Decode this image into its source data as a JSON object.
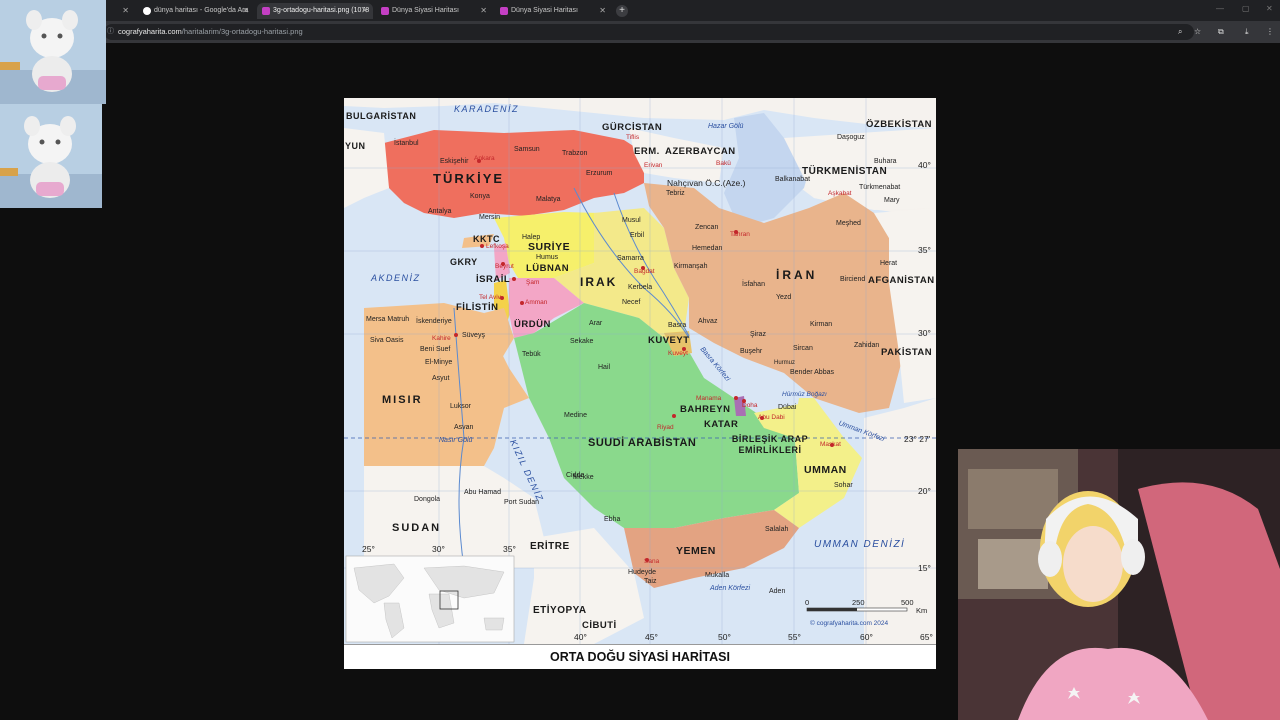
{
  "browser": {
    "tabs": [
      {
        "title": "dünya haritası - Google'da Ara",
        "favicon": "google-icon"
      },
      {
        "title": "3g-ortadogu-haritasi.png (1078",
        "favicon": "image-icon"
      },
      {
        "title": "Dünya Siyasi Haritası",
        "favicon": "site-icon"
      },
      {
        "title": "Dünya Siyasi Haritası",
        "favicon": "site-icon"
      }
    ],
    "url_host": "cografyaharita.com",
    "url_path": "/haritalarim/3g-ortadogu-haritasi.png"
  },
  "map": {
    "caption": "ORTA DOĞU SİYASİ HARİTASI",
    "countries": [
      "TÜRKİYE",
      "SURİYE",
      "LÜBNAN",
      "IRAK",
      "İRAN",
      "İSRAİL",
      "FİLİSTİN",
      "ÜRDÜN",
      "MISIR",
      "SUUDİ ARABİSTAN",
      "KUVEYT",
      "BAHREYN",
      "KATAR",
      "BİRLEŞİK ARAP EMİRLİKLERİ",
      "UMMAN",
      "YEMEN",
      "ERİTRE",
      "ETİYOPYA",
      "CİBUTİ",
      "SUDAN",
      "GÜRCİSTAN",
      "ERM.",
      "AZERBAYCAN",
      "TÜRKMENİSTAN",
      "ÖZBEKİSTAN",
      "AFGANİSTAN",
      "PAKİSTAN",
      "BULGARİSTAN",
      "YUN",
      "KKTC",
      "GKRY",
      "Nahçıvan Ö.C.(Aze.)"
    ],
    "seas": [
      "KARADENİZ",
      "AKDENİZ",
      "KIZIL DENİZ",
      "UMMAN DENİZİ",
      "Basra Körfezi",
      "Hazar Gölü",
      "Umman Körfezi",
      "Aden Körfezi",
      "Hürmüz Boğazı"
    ],
    "capitals": [
      "Ankara",
      "Lefkoşa",
      "Beyrut",
      "Şam",
      "Tel Aviv",
      "Amman",
      "Bağdat",
      "Tahran",
      "Kuveyt",
      "Riyad",
      "Doha",
      "Abu Dabi",
      "Maskat",
      "Sana",
      "Kahire",
      "Manama",
      "Tiflis",
      "Erivan",
      "Bakü",
      "Aşkabat"
    ],
    "cities": [
      "İstanbul",
      "Samsun",
      "Trabzon",
      "Erzurum",
      "Eskişehir",
      "Konya",
      "Antalya",
      "Mersin",
      "Malatya",
      "Halep",
      "Humus",
      "Musul",
      "Erbil",
      "Basra",
      "Tebriz",
      "Meşhed",
      "İsfahan",
      "Şiraz",
      "Yezd",
      "Kirman",
      "Cidde",
      "Mekke",
      "Medine",
      "Hail",
      "Tebük",
      "Aden",
      "Port Sudan",
      "Asvan",
      "Luksor",
      "Süveyş",
      "İskenderiye",
      "Bender Abbas",
      "Zahidan",
      "Dübai",
      "Sohar",
      "Salalah",
      "Mukalla",
      "Hudeyde",
      "Taiz",
      "Mersa Matruh",
      "Siva Oasis",
      "Beni Suef",
      "El-Minye",
      "Asyut",
      "Nasır Gölü",
      "Abu Hamad",
      "Dongola",
      "Ebha",
      "Sekake",
      "Arar",
      "Necef",
      "Kerbela",
      "Samarra",
      "Zencan",
      "Hemedan",
      "Kirmanşah",
      "Ahvaz",
      "Buşehr",
      "Sircan",
      "Birciend",
      "Herat",
      "Mary",
      "Buhara",
      "Daşoguz",
      "Türkmenabat",
      "Balkanabat",
      "Hurmuz",
      "Kuveyt"
    ],
    "lat_labels": [
      "40°",
      "35°",
      "30°",
      "23° 27'",
      "20°",
      "15°"
    ],
    "lon_labels": [
      "25°",
      "30°",
      "35°",
      "40°",
      "45°",
      "50°",
      "55°",
      "60°",
      "65°"
    ],
    "scale": {
      "values": [
        "0",
        "250",
        "500"
      ],
      "unit": "Km"
    },
    "credit": "© cografyaharita.com 2024"
  },
  "colors": {
    "turkey": "#ef6f5e",
    "syria": "#f6f06b",
    "iraq": "#f3e98a",
    "iran": "#e9b48c",
    "saudi": "#8ad98c",
    "egypt": "#f3c08a",
    "oman": "#f3f08a",
    "yemen": "#e3a382",
    "sea": "#d9e6f5",
    "caspian": "#c4d6ef"
  }
}
